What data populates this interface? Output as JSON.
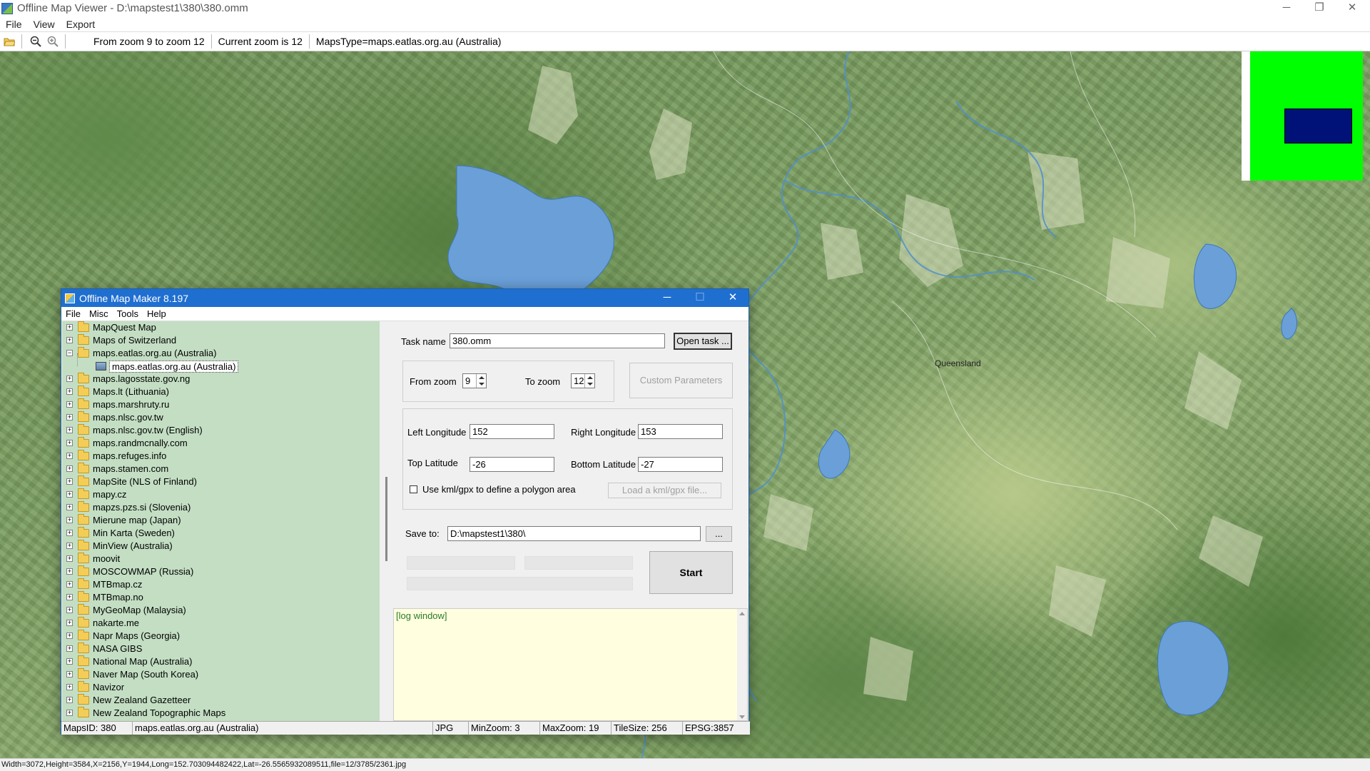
{
  "viewer": {
    "title": "Offline Map Viewer - D:\\mapstest1\\380\\380.omm",
    "menu": [
      "File",
      "View",
      "Export"
    ],
    "toolbar": {
      "info_zoom_range": "From zoom 9 to zoom 12",
      "info_current_zoom": "Current zoom is 12",
      "info_maps_type": "MapsType=maps.eatlas.org.au (Australia)"
    },
    "map_label": "Queensland",
    "status": "Width=3072,Height=3584,X=2156,Y=1944,Long=152.703094482422,Lat=-26.5565932089511,file=12/3785/2361.jpg",
    "window_controls": {
      "minimize": "─",
      "restore": "❐",
      "close": "✕"
    }
  },
  "maker": {
    "title": "Offline Map Maker 8.197",
    "window_controls": {
      "minimize": "─",
      "maximize": "☐",
      "close": "✕"
    },
    "menu": [
      "File",
      "Misc",
      "Tools",
      "Help"
    ],
    "tree": [
      {
        "label": "MapQuest Map",
        "expanded": false
      },
      {
        "label": "Maps of Switzerland",
        "expanded": false
      },
      {
        "label": "maps.eatlas.org.au (Australia)",
        "expanded": true
      },
      {
        "label": "maps.eatlas.org.au (Australia)",
        "child": true,
        "selected": true
      },
      {
        "label": "maps.lagosstate.gov.ng",
        "expanded": false
      },
      {
        "label": "Maps.lt (Lithuania)",
        "expanded": false
      },
      {
        "label": "maps.marshruty.ru",
        "expanded": false
      },
      {
        "label": "maps.nlsc.gov.tw",
        "expanded": false
      },
      {
        "label": "maps.nlsc.gov.tw (English)",
        "expanded": false
      },
      {
        "label": "maps.randmcnally.com",
        "expanded": false
      },
      {
        "label": "maps.refuges.info",
        "expanded": false
      },
      {
        "label": "maps.stamen.com",
        "expanded": false
      },
      {
        "label": "MapSite (NLS of Finland)",
        "expanded": false
      },
      {
        "label": "mapy.cz",
        "expanded": false
      },
      {
        "label": "mapzs.pzs.si (Slovenia)",
        "expanded": false
      },
      {
        "label": "Mierune map (Japan)",
        "expanded": false
      },
      {
        "label": "Min Karta (Sweden)",
        "expanded": false
      },
      {
        "label": "MinView (Australia)",
        "expanded": false
      },
      {
        "label": "moovit",
        "expanded": false
      },
      {
        "label": "MOSCOWMAP (Russia)",
        "expanded": false
      },
      {
        "label": "MTBmap.cz",
        "expanded": false
      },
      {
        "label": "MTBmap.no",
        "expanded": false
      },
      {
        "label": "MyGeoMap (Malaysia)",
        "expanded": false
      },
      {
        "label": "nakarte.me",
        "expanded": false
      },
      {
        "label": "Napr Maps (Georgia)",
        "expanded": false
      },
      {
        "label": "NASA GIBS",
        "expanded": false
      },
      {
        "label": "National Map (Australia)",
        "expanded": false
      },
      {
        "label": "Naver Map (South Korea)",
        "expanded": false
      },
      {
        "label": "Navizor",
        "expanded": false
      },
      {
        "label": "New Zealand Gazetteer",
        "expanded": false
      },
      {
        "label": "New Zealand Topographic Maps",
        "expanded": false
      }
    ],
    "form": {
      "task_name_label": "Task name",
      "task_name_value": "380.omm",
      "open_task_button": "Open task ...",
      "from_zoom_label": "From zoom",
      "from_zoom_value": "9",
      "to_zoom_label": "To zoom",
      "to_zoom_value": "12",
      "custom_params_button": "Custom Parameters",
      "left_lon_label": "Left Longitude",
      "left_lon_value": "152",
      "right_lon_label": "Right Longitude",
      "right_lon_value": "153",
      "top_lat_label": "Top Latitude",
      "top_lat_value": "-26",
      "bottom_lat_label": "Bottom Latitude",
      "bottom_lat_value": "-27",
      "kml_checkbox_label": "Use kml/gpx to define a polygon area",
      "kml_checked": false,
      "load_kml_button": "Load a kml/gpx file...",
      "save_to_label": "Save to:",
      "save_to_value": "D:\\mapstest1\\380\\",
      "browse_button": "...",
      "start_button": "Start"
    },
    "log_text": "[log window]",
    "status": {
      "maps_id": "MapsID: 380",
      "maps_name": "maps.eatlas.org.au (Australia)",
      "format": "JPG",
      "min_zoom": "MinZoom: 3",
      "max_zoom": "MaxZoom: 19",
      "tile_size": "TileSize: 256",
      "epsg": "EPSG:3857"
    }
  },
  "colors": {
    "title_blue": "#1f6fd0",
    "tree_green": "#c3dec3",
    "minimap_green": "#00ff00",
    "minimap_viewport": "#001177",
    "log_bg": "#ffffdf"
  }
}
